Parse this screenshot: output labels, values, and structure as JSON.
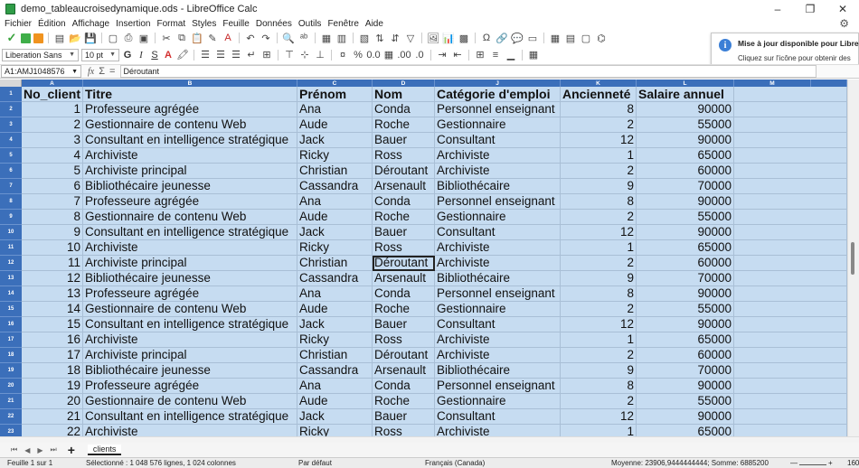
{
  "window": {
    "title": "demo_tableaucroisedynamique.ods - LibreOffice Calc",
    "controls": [
      "–",
      "❐",
      "✕"
    ]
  },
  "menu": [
    "Fichier",
    "Édition",
    "Affichage",
    "Insertion",
    "Format",
    "Styles",
    "Feuille",
    "Données",
    "Outils",
    "Fenêtre",
    "Aide"
  ],
  "formatbar": {
    "font_name": "Liberation Sans",
    "font_size": "10 pt",
    "bold": "G",
    "italic": "I",
    "underline": "S",
    "strike": "S",
    "font_color": "A"
  },
  "formulabar": {
    "name_box": "A1:AMJ1048576",
    "fx": "fx",
    "sum": "Σ",
    "equals": "=",
    "content": "Déroutant"
  },
  "notification": {
    "title": "Mise à jour disponible pour LibreOffice",
    "body": "Cliquez sur l'icône pour obtenir des informations supplémentaires."
  },
  "sheet": {
    "columns": [
      "A",
      "B",
      "C",
      "D",
      "J",
      "K",
      "L",
      "M"
    ],
    "headers": [
      "No_client",
      "Titre",
      "Prénom",
      "Nom",
      "Catégorie d'emploi",
      "Ancienneté",
      "Salaire annuel"
    ],
    "row_numbers": [
      "1",
      "2",
      "3",
      "4",
      "5",
      "6",
      "7",
      "8",
      "9",
      "10",
      "11",
      "12",
      "13",
      "14",
      "15",
      "16",
      "17",
      "18",
      "19",
      "20",
      "21",
      "22",
      "23"
    ],
    "rows": [
      [
        "1",
        "Professeure agrégée",
        "Ana",
        "Conda",
        "Personnel enseignant",
        "8",
        "90000"
      ],
      [
        "2",
        "Gestionnaire de contenu Web",
        "Aude",
        "Roche",
        "Gestionnaire",
        "2",
        "55000"
      ],
      [
        "3",
        "Consultant en intelligence stratégique",
        "Jack",
        "Bauer",
        "Consultant",
        "12",
        "90000"
      ],
      [
        "4",
        "Archiviste",
        "Ricky",
        "Ross",
        "Archiviste",
        "1",
        "65000"
      ],
      [
        "5",
        "Archiviste principal",
        "Christian",
        "Déroutant",
        "Archiviste",
        "2",
        "60000"
      ],
      [
        "6",
        "Bibliothécaire jeunesse",
        "Cassandra",
        "Arsenault",
        "Bibliothécaire",
        "9",
        "70000"
      ],
      [
        "7",
        "Professeure agrégée",
        "Ana",
        "Conda",
        "Personnel enseignant",
        "8",
        "90000"
      ],
      [
        "8",
        "Gestionnaire de contenu Web",
        "Aude",
        "Roche",
        "Gestionnaire",
        "2",
        "55000"
      ],
      [
        "9",
        "Consultant en intelligence stratégique",
        "Jack",
        "Bauer",
        "Consultant",
        "12",
        "90000"
      ],
      [
        "10",
        "Archiviste",
        "Ricky",
        "Ross",
        "Archiviste",
        "1",
        "65000"
      ],
      [
        "11",
        "Archiviste principal",
        "Christian",
        "Déroutant",
        "Archiviste",
        "2",
        "60000"
      ],
      [
        "12",
        "Bibliothécaire jeunesse",
        "Cassandra",
        "Arsenault",
        "Bibliothécaire",
        "9",
        "70000"
      ],
      [
        "13",
        "Professeure agrégée",
        "Ana",
        "Conda",
        "Personnel enseignant",
        "8",
        "90000"
      ],
      [
        "14",
        "Gestionnaire de contenu Web",
        "Aude",
        "Roche",
        "Gestionnaire",
        "2",
        "55000"
      ],
      [
        "15",
        "Consultant en intelligence stratégique",
        "Jack",
        "Bauer",
        "Consultant",
        "12",
        "90000"
      ],
      [
        "16",
        "Archiviste",
        "Ricky",
        "Ross",
        "Archiviste",
        "1",
        "65000"
      ],
      [
        "17",
        "Archiviste principal",
        "Christian",
        "Déroutant",
        "Archiviste",
        "2",
        "60000"
      ],
      [
        "18",
        "Bibliothécaire jeunesse",
        "Cassandra",
        "Arsenault",
        "Bibliothécaire",
        "9",
        "70000"
      ],
      [
        "19",
        "Professeure agrégée",
        "Ana",
        "Conda",
        "Personnel enseignant",
        "8",
        "90000"
      ],
      [
        "20",
        "Gestionnaire de contenu Web",
        "Aude",
        "Roche",
        "Gestionnaire",
        "2",
        "55000"
      ],
      [
        "21",
        "Consultant en intelligence stratégique",
        "Jack",
        "Bauer",
        "Consultant",
        "12",
        "90000"
      ],
      [
        "22",
        "Archiviste",
        "Ricky",
        "Ross",
        "Archiviste",
        "1",
        "65000"
      ]
    ],
    "active_cell_text": "Déroutant"
  },
  "tabs": {
    "sheet_name": "clients",
    "add": "+"
  },
  "status": {
    "sheet": "Feuille 1 sur 1",
    "selection": "Sélectionné : 1 048 576 lignes, 1 024 colonnes",
    "style": "Par défaut",
    "language": "Français (Canada)",
    "stats": "Moyenne: 23906,9444444444; Somme: 6885200",
    "zoom": "160"
  },
  "colors": {
    "header_blue": "#3b6fba",
    "selection_fill": "#c6dcf1",
    "accent_green": "#38a33c"
  }
}
